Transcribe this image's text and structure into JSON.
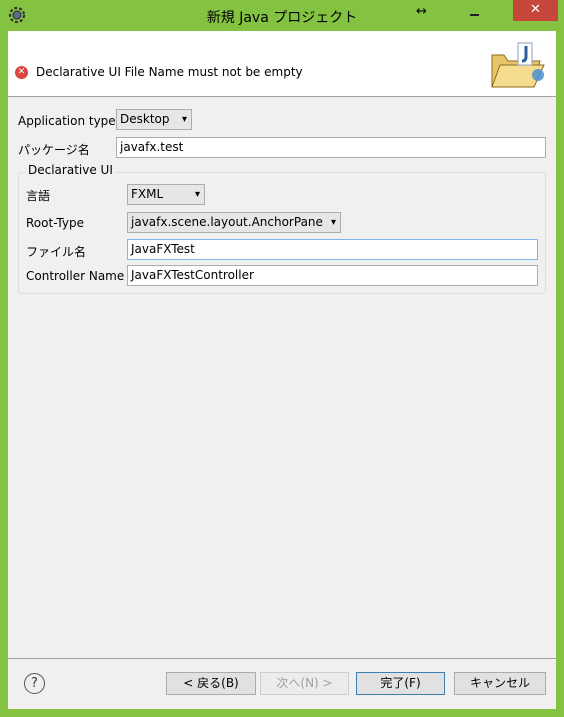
{
  "window": {
    "title": "新規 Java プロジェクト",
    "close_glyph": "✕",
    "resize_glyph": "↔"
  },
  "banner": {
    "error_message": "Declarative UI File Name must not be empty",
    "error_icon": "error-icon"
  },
  "form": {
    "application_type_label": "Application type",
    "application_type_value": "Desktop",
    "package_label": "パッケージ名",
    "package_value": "javafx.test",
    "group_title": "Declarative UI",
    "language_label": "言語",
    "language_value": "FXML",
    "root_type_label": "Root-Type",
    "root_type_value": "javafx.scene.layout.AnchorPane",
    "file_name_label": "ファイル名",
    "file_name_value": "JavaFXTest",
    "controller_label": "Controller Name",
    "controller_value": "JavaFXTestController"
  },
  "buttons": {
    "back": "< 戻る(B)",
    "next": "次へ(N) >",
    "finish": "完了(F)",
    "cancel": "キャンセル",
    "help": "?"
  },
  "colors": {
    "window_frame": "#84c341",
    "close_button": "#c7463c",
    "error_icon": "#d9463f"
  }
}
